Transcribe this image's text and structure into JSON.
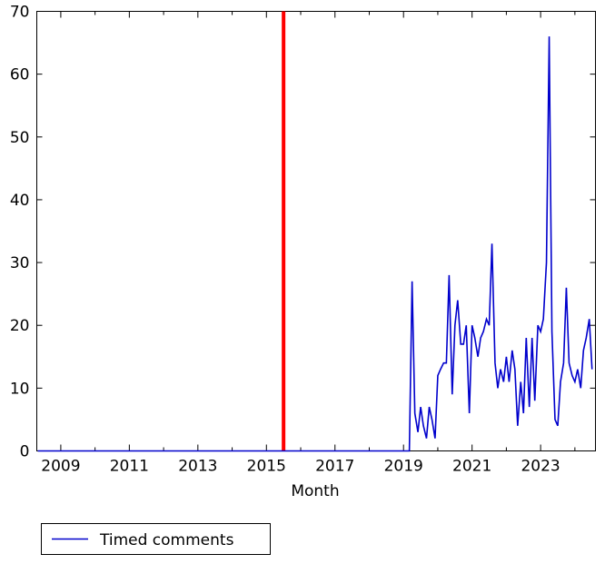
{
  "chart_data": {
    "type": "line",
    "title": "",
    "xlabel": "Month",
    "ylabel": "",
    "xlim": [
      2008.3,
      2024.6
    ],
    "ylim": [
      0,
      70
    ],
    "grid": false,
    "legend_position": "below-left",
    "x_tick_labels": [
      "2009",
      "2011",
      "2013",
      "2015",
      "2017",
      "2019",
      "2021",
      "2023"
    ],
    "x_tick_values": [
      2009,
      2011,
      2013,
      2015,
      2017,
      2019,
      2021,
      2023
    ],
    "x_minor_tick_values": [
      2010,
      2012,
      2014,
      2016,
      2018,
      2020,
      2022,
      2024
    ],
    "y_tick_labels": [
      "0",
      "10",
      "20",
      "30",
      "40",
      "50",
      "60",
      "70"
    ],
    "y_tick_values": [
      0,
      10,
      20,
      30,
      40,
      50,
      60,
      70
    ],
    "series": [
      {
        "name": "Timed comments",
        "color": "#0000CC",
        "x": [
          2008.33,
          2008.42,
          2008.5,
          2008.58,
          2008.67,
          2008.75,
          2008.83,
          2008.92,
          2009.0,
          2009.08,
          2009.17,
          2009.25,
          2009.33,
          2009.42,
          2009.5,
          2009.58,
          2009.67,
          2009.75,
          2009.83,
          2009.92,
          2010.0,
          2010.08,
          2010.17,
          2010.25,
          2010.33,
          2010.42,
          2010.5,
          2010.58,
          2010.67,
          2010.75,
          2010.83,
          2010.92,
          2011.0,
          2011.08,
          2011.17,
          2011.25,
          2011.33,
          2011.42,
          2011.5,
          2011.58,
          2011.67,
          2011.75,
          2011.83,
          2011.92,
          2012.0,
          2012.08,
          2012.17,
          2012.25,
          2012.33,
          2012.42,
          2012.5,
          2012.58,
          2012.67,
          2012.75,
          2012.83,
          2012.92,
          2013.0,
          2013.08,
          2013.17,
          2013.25,
          2013.33,
          2013.42,
          2013.5,
          2013.58,
          2013.67,
          2013.75,
          2013.83,
          2013.92,
          2014.0,
          2014.08,
          2014.17,
          2014.25,
          2014.33,
          2014.42,
          2014.5,
          2014.58,
          2014.67,
          2014.75,
          2014.83,
          2014.92,
          2015.0,
          2015.08,
          2015.17,
          2015.25,
          2015.33,
          2015.42,
          2015.5,
          2015.58,
          2015.67,
          2015.75,
          2015.83,
          2015.92,
          2016.0,
          2016.08,
          2016.17,
          2016.25,
          2016.33,
          2016.42,
          2016.5,
          2016.58,
          2016.67,
          2016.75,
          2016.83,
          2016.92,
          2017.0,
          2017.08,
          2017.17,
          2017.25,
          2017.33,
          2017.42,
          2017.5,
          2017.58,
          2017.67,
          2017.75,
          2017.83,
          2017.92,
          2018.0,
          2018.08,
          2018.17,
          2018.25,
          2018.33,
          2018.42,
          2018.5,
          2018.58,
          2018.67,
          2018.75,
          2018.83,
          2018.92,
          2019.0,
          2019.08,
          2019.17,
          2019.25,
          2019.33,
          2019.42,
          2019.5,
          2019.58,
          2019.67,
          2019.75,
          2019.83,
          2019.92,
          2020.0,
          2020.08,
          2020.17,
          2020.25,
          2020.33,
          2020.42,
          2020.5,
          2020.58,
          2020.67,
          2020.75,
          2020.83,
          2020.92,
          2021.0,
          2021.08,
          2021.17,
          2021.25,
          2021.33,
          2021.42,
          2021.5,
          2021.58,
          2021.67,
          2021.75,
          2021.83,
          2021.92,
          2022.0,
          2022.08,
          2022.17,
          2022.25,
          2022.33,
          2022.42,
          2022.5,
          2022.58,
          2022.67,
          2022.75,
          2022.83,
          2022.92,
          2023.0,
          2023.08,
          2023.17,
          2023.25,
          2023.33,
          2023.42,
          2023.5,
          2023.58,
          2023.67,
          2023.75,
          2023.83,
          2023.92,
          2024.0,
          2024.08,
          2024.17,
          2024.25,
          2024.33,
          2024.42,
          2024.5
        ],
        "y": [
          0,
          0,
          0,
          0,
          0,
          0,
          0,
          0,
          0,
          0,
          0,
          0,
          0,
          0,
          0,
          0,
          0,
          0,
          0,
          0,
          0,
          0,
          0,
          0,
          0,
          0,
          0,
          0,
          0,
          0,
          0,
          0,
          0,
          0,
          0,
          0,
          0,
          0,
          0,
          0,
          0,
          0,
          0,
          0,
          0,
          0,
          0,
          0,
          0,
          0,
          0,
          0,
          0,
          0,
          0,
          0,
          0,
          0,
          0,
          0,
          0,
          0,
          0,
          0,
          0,
          0,
          0,
          0,
          0,
          0,
          0,
          0,
          0,
          0,
          0,
          0,
          0,
          0,
          0,
          0,
          0,
          0,
          0,
          0,
          0,
          0,
          0,
          0,
          0,
          0,
          0,
          0,
          0,
          0,
          0,
          0,
          0,
          0,
          0,
          0,
          0,
          0,
          0,
          0,
          0,
          0,
          0,
          0,
          0,
          0,
          0,
          0,
          0,
          0,
          0,
          0,
          0,
          0,
          0,
          0,
          0,
          0,
          0,
          0,
          0,
          0,
          0,
          0,
          0,
          0,
          0,
          27,
          6,
          3,
          7,
          4,
          2,
          7,
          5,
          2,
          12,
          13,
          14,
          14,
          28,
          9,
          20,
          24,
          17,
          17,
          20,
          6,
          20,
          18,
          15,
          18,
          19,
          21,
          20,
          33,
          14,
          10,
          13,
          11,
          15,
          11,
          16,
          13,
          4,
          11,
          6,
          18,
          7,
          18,
          8,
          20,
          19,
          21,
          30,
          66,
          19,
          5,
          4,
          11,
          14,
          26,
          14,
          12,
          11,
          13,
          10,
          16,
          18,
          21,
          13
        ]
      }
    ],
    "annotations": [
      {
        "type": "vertical-line",
        "x": 2015.5,
        "color": "#FF0000",
        "linewidth": 4
      }
    ]
  },
  "legend": {
    "entries": [
      {
        "label": "Timed comments",
        "color": "#0000CC"
      }
    ]
  },
  "axes": {
    "xlabel": "Month"
  }
}
